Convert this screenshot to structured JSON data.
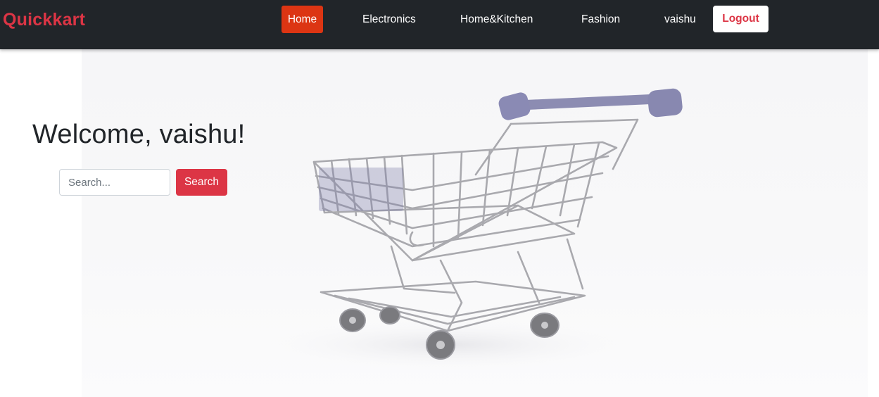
{
  "navbar": {
    "brand": "Quickkart",
    "links": [
      {
        "label": "Home",
        "active": true
      },
      {
        "label": "Electronics"
      },
      {
        "label": "Home&Kitchen"
      },
      {
        "label": "Fashion"
      }
    ],
    "username": "vaishu",
    "logout_label": "Logout"
  },
  "hero": {
    "welcome": "Welcome, vaishu!",
    "search": {
      "placeholder": "Search...",
      "value": "",
      "button_label": "Search"
    },
    "image": "shopping-cart-photo"
  },
  "colors": {
    "navbar_bg": "#212529",
    "brand": "#dc3545",
    "active_nav": "#dc3513",
    "search_button": "#dc3545"
  }
}
